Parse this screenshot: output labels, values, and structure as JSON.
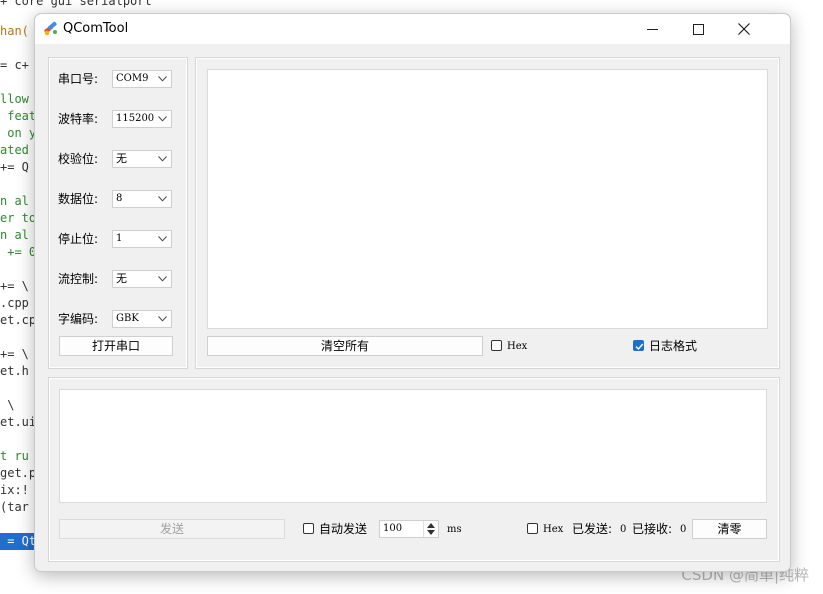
{
  "background_code": {
    "lines": [
      {
        "text": "+ core gui serialport",
        "style": ""
      },
      {
        "text": "han(",
        "style": "orange"
      },
      {
        "text": "= c+",
        "style": ""
      },
      {
        "text": "llow",
        "style": "green"
      },
      {
        "text": " feat",
        "style": "green"
      },
      {
        "text": " on y",
        "style": "green"
      },
      {
        "text": "ated",
        "style": "green"
      },
      {
        "text": "+= Q",
        "style": ""
      },
      {
        "text": "n al",
        "style": "green"
      },
      {
        "text": "er to",
        "style": "green"
      },
      {
        "text": "n al",
        "style": "green"
      },
      {
        "text": " += 0",
        "style": "green"
      },
      {
        "text": "+= \\",
        "style": ""
      },
      {
        "text": ".cpp",
        "style": ""
      },
      {
        "text": "et.cp",
        "style": ""
      },
      {
        "text": "+= \\",
        "style": ""
      },
      {
        "text": "et.h",
        "style": ""
      },
      {
        "text": " \\",
        "style": ""
      },
      {
        "text": "et.ui",
        "style": ""
      },
      {
        "text": "t ru",
        "style": "green"
      },
      {
        "text": "get.p",
        "style": ""
      },
      {
        "text": "ix:!",
        "style": ""
      },
      {
        "text": "(tar",
        "style": ""
      },
      {
        "text": " = Qt",
        "style": "sel"
      }
    ]
  },
  "watermark": "CSDN @简单|纯粹",
  "window": {
    "title": "QComTool",
    "controls": {
      "minimize": "minimize-icon",
      "maximize": "maximize-icon",
      "close": "close-icon"
    }
  },
  "settings": {
    "port_label": "串口号:",
    "port_value": "COM9",
    "baud_label": "波特率:",
    "baud_value": "115200",
    "parity_label": "校验位:",
    "parity_value": "无",
    "databits_label": "数据位:",
    "databits_value": "8",
    "stopbits_label": "停止位:",
    "stopbits_value": "1",
    "flow_label": "流控制:",
    "flow_value": "无",
    "encoding_label": "字编码:",
    "encoding_value": "GBK",
    "open_button": "打开串口"
  },
  "receive": {
    "text": "",
    "clear_button": "清空所有",
    "hex_label": "Hex",
    "hex_checked": false,
    "log_label": "日志格式",
    "log_checked": true
  },
  "send": {
    "text": "",
    "send_button": "发送",
    "auto_label": "自动发送",
    "auto_checked": false,
    "interval_value": "100",
    "interval_unit": "ms",
    "hex_label": "Hex",
    "hex_checked": false,
    "sent_label": "已发送:",
    "sent_count": "0",
    "received_label": "已接收:",
    "received_count": "0",
    "clear_button": "清零"
  },
  "colors": {
    "accent": "#1b6fd1",
    "selection": "#1f6fd1",
    "code_green": "#2f8a2f"
  }
}
